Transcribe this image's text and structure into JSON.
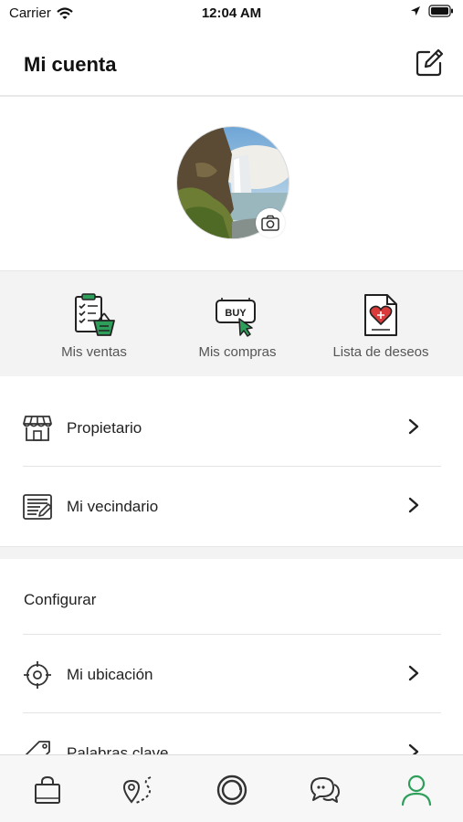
{
  "status_bar": {
    "carrier": "Carrier",
    "time": "12:04 AM"
  },
  "header": {
    "title": "Mi cuenta"
  },
  "quick_actions": [
    {
      "label": "Mis ventas",
      "icon": "checklist-basket-icon"
    },
    {
      "label": "Mis compras",
      "icon": "buy-sign-icon"
    },
    {
      "label": "Lista de deseos",
      "icon": "heart-document-icon"
    }
  ],
  "menu": [
    {
      "label": "Propietario",
      "icon": "storefront-icon"
    },
    {
      "label": "Mi vecindario",
      "icon": "newspaper-icon"
    }
  ],
  "settings": {
    "title": "Configurar",
    "items": [
      {
        "label": "Mi ubicación",
        "icon": "crosshair-location-icon"
      },
      {
        "label": "Palabras clave",
        "icon": "tag-icon"
      }
    ]
  },
  "tabbar": {
    "items": [
      "shopping-bag-icon",
      "map-route-icon",
      "camera-lens-icon",
      "chat-bubbles-icon",
      "user-profile-icon"
    ],
    "active_index": 4
  },
  "colors": {
    "accent_green": "#2e9e5b",
    "text": "#222222",
    "muted": "#555555"
  }
}
